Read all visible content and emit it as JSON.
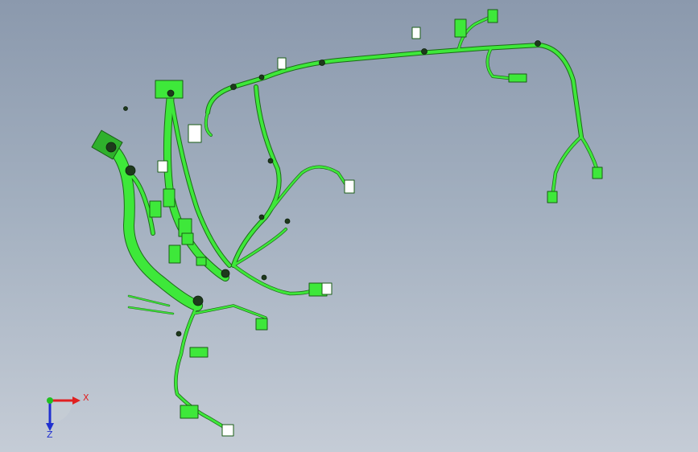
{
  "scene": {
    "type": "3d-cad-wire-harness",
    "harness_color": "#3ee83a",
    "outline_color": "#1a5c16",
    "connector_color": "#ffffff"
  },
  "triad": {
    "x_label": "X",
    "z_label": "Z",
    "x_color": "#e02020",
    "y_color": "#20c020",
    "z_color": "#2030d0"
  }
}
